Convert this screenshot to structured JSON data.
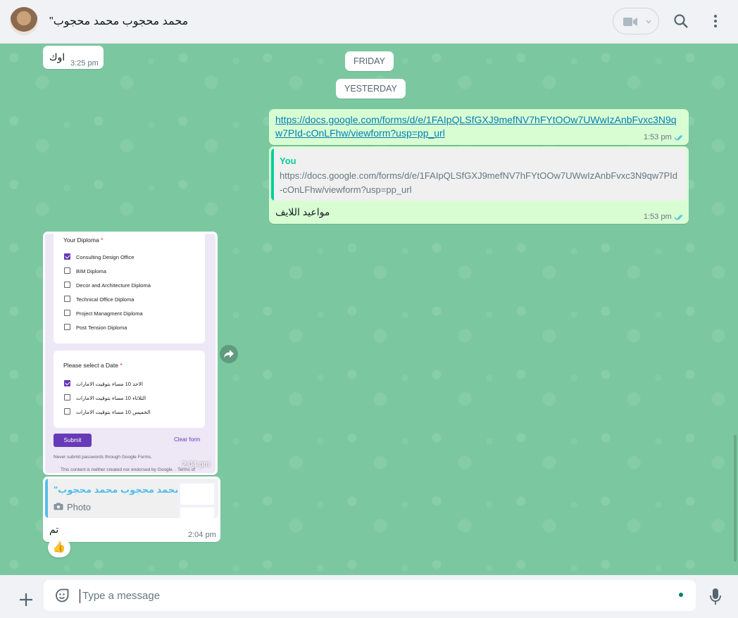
{
  "header": {
    "contact_name": "\"محمد محجوب محمد محجوب",
    "icons": [
      "avatar",
      "video-call-icon",
      "chevron-down-icon",
      "search-icon",
      "menu-icon"
    ]
  },
  "messages": {
    "m1_text": "اوك",
    "m1_time": "3:25 pm",
    "chip_friday": "FRIDAY",
    "chip_yesterday": "YESTERDAY",
    "m2_link_line1": "https://docs.google.com/forms/d/e/1FAIpQLSfGXJ9mefNV7hFYtOOw7UWwIzAnbFvxc3N9q",
    "m2_link_line2": "w7PId-cOnLFhw/viewform?usp=pp_url",
    "m2_time": "1:53 pm",
    "m3_quote_author": "You",
    "m3_quote_line1": "https://docs.google.com/forms/d/e/1FAIpQLSfGXJ9mefNV7hFYtOOw7UWwIzAnbFvxc3N9qw7PId",
    "m3_quote_line2": "-cOnLFhw/viewform?usp=pp_url",
    "m3_text": "مواعيد اللايف",
    "m3_time": "1:53 pm",
    "m4_time": "2:04 pm",
    "m5_quote_author": "\"محمد محجوب محمد محجوب",
    "m5_quote_type": "Photo",
    "m5_text": "تم",
    "m5_time": "2:04 pm",
    "m5_reaction": "👍"
  },
  "form_image": {
    "q1_title": "Your Diploma",
    "q1_required": "*",
    "q1_options": [
      {
        "label": "Consulting Design Office",
        "checked": true
      },
      {
        "label": "BIM Diploma",
        "checked": false
      },
      {
        "label": "Decor and Architecture Diploma",
        "checked": false
      },
      {
        "label": "Technical Office Diploma",
        "checked": false
      },
      {
        "label": "Project Managment Diploma",
        "checked": false
      },
      {
        "label": "Post Tension Diploma",
        "checked": false
      }
    ],
    "q2_title": "Please select a Date",
    "q2_required": "*",
    "q2_options": [
      {
        "label": "الاحد 10 مساء بتوقيت الامارات",
        "checked": true
      },
      {
        "label": "الثلاثاء 10 مساء بتوقيت الامارات",
        "checked": false
      },
      {
        "label": "الخميس 10 مساء بتوقيت الامارات",
        "checked": false
      }
    ],
    "submit_label": "Submit",
    "clear_label": "Clear form",
    "never_submit": "Never submit passwords through Google Forms.",
    "not_endorsed": "This content is neither created nor endorsed by Google. · Terms of"
  },
  "composer": {
    "placeholder": "Type a message"
  },
  "colors": {
    "chat_bg": "#7bc8a0",
    "outgoing": "#d9fdd3",
    "incoming": "#ffffff",
    "accent": "#00a884",
    "form_purple": "#673ab7",
    "reply_author_green": "#06cf9c",
    "reply_author_blue": "#53bdeb"
  }
}
